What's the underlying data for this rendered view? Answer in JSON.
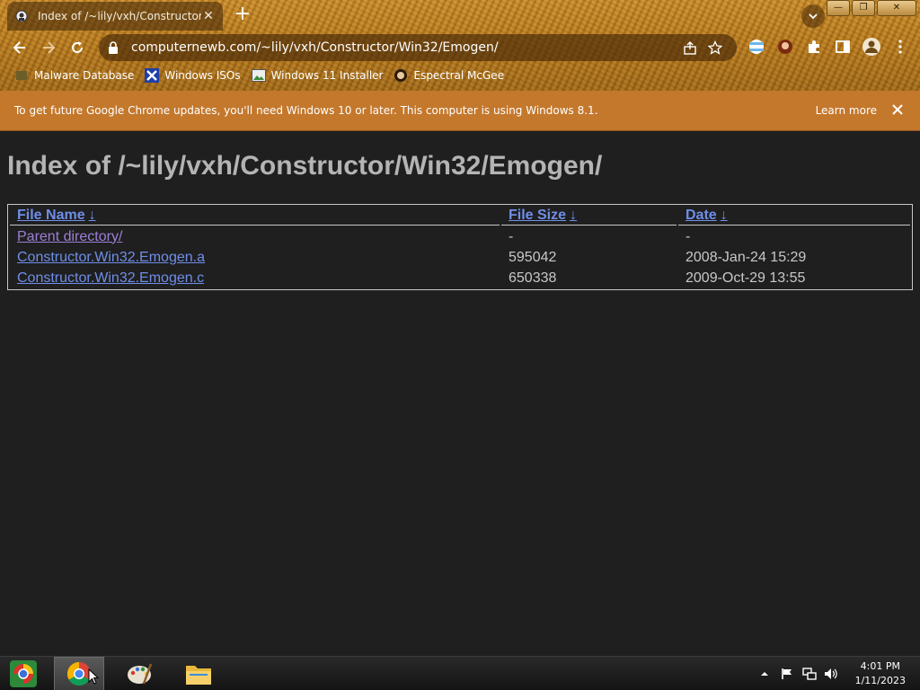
{
  "browser": {
    "tab_title": "Index of /~lily/vxh/Constructor",
    "url": "computernewb.com/~lily/vxh/Constructor/Win32/Emogen/",
    "bookmarks": [
      {
        "label": "Malware Database",
        "icon": "database-icon"
      },
      {
        "label": "Windows ISOs",
        "icon": "x-logo-icon"
      },
      {
        "label": "Windows 11 Installer",
        "icon": "image-icon"
      },
      {
        "label": "Espectral McGee",
        "icon": "avatar-icon"
      }
    ]
  },
  "infobar": {
    "message": "To get future Google Chrome updates, you'll need Windows 10 or later. This computer is using Windows 8.1.",
    "learn_more": "Learn more"
  },
  "page": {
    "heading": "Index of /~lily/vxh/Constructor/Win32/Emogen/",
    "columns": [
      {
        "label": "File Name",
        "sort": "↓"
      },
      {
        "label": "File Size",
        "sort": "↓"
      },
      {
        "label": "Date",
        "sort": "↓"
      }
    ],
    "rows": [
      {
        "name": "Parent directory/",
        "size": "-",
        "date": "-"
      },
      {
        "name": "Constructor.Win32.Emogen.a",
        "size": "595042",
        "date": "2008-Jan-24 15:29"
      },
      {
        "name": "Constructor.Win32.Emogen.c",
        "size": "650338",
        "date": "2009-Oct-29 13:55"
      }
    ]
  },
  "taskbar": {
    "time": "4:01 PM",
    "date": "1/11/2023"
  },
  "colors": {
    "link": "#6f8ee8",
    "visited_link": "#9d7fd6",
    "infobar": "#c4782c",
    "page_bg": "#1f1f1f"
  }
}
